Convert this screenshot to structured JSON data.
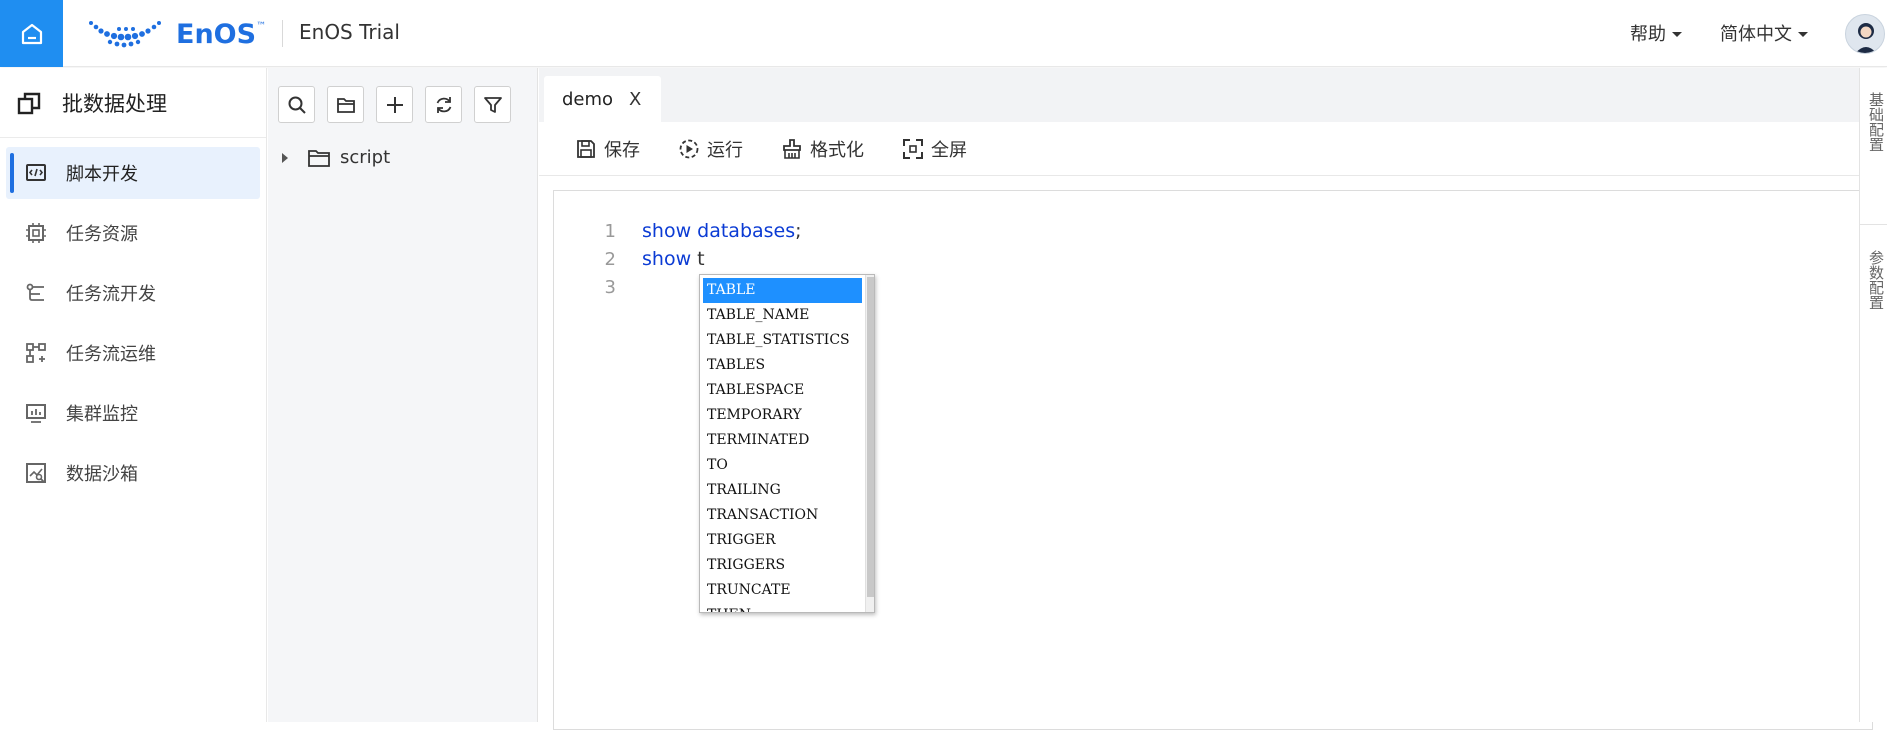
{
  "brand": {
    "logo_text": "EnOS",
    "logo_tm": "™",
    "app_title": "EnOS Trial",
    "accent": "#1f8ef1"
  },
  "top_menu": {
    "help": "帮助",
    "language": "简体中文"
  },
  "sidebar": {
    "title": "批数据处理",
    "items": [
      {
        "label": "脚本开发",
        "icon": "script-dev-icon",
        "active": true
      },
      {
        "label": "任务资源",
        "icon": "task-resource-icon",
        "active": false
      },
      {
        "label": "任务流开发",
        "icon": "workflow-dev-icon",
        "active": false
      },
      {
        "label": "任务流运维",
        "icon": "workflow-ops-icon",
        "active": false
      },
      {
        "label": "集群监控",
        "icon": "cluster-monitor-icon",
        "active": false
      },
      {
        "label": "数据沙箱",
        "icon": "data-sandbox-icon",
        "active": false
      }
    ]
  },
  "tree": {
    "toolbar": [
      "search-icon",
      "folder-icon",
      "add-icon",
      "refresh-icon",
      "filter-icon"
    ],
    "nodes": [
      {
        "label": "script"
      }
    ]
  },
  "editor": {
    "tab": {
      "label": "demo",
      "close": "X"
    },
    "toolbar": {
      "save": "保存",
      "run": "运行",
      "format": "格式化",
      "fullscreen": "全屏"
    },
    "lines": [
      {
        "no": "1",
        "keyword": "show",
        "rest": "databases",
        "punct": ";"
      },
      {
        "no": "2",
        "keyword": "show",
        "rest": "",
        "punct": "t"
      },
      {
        "no": "3",
        "keyword": "",
        "rest": "",
        "punct": ""
      }
    ]
  },
  "autocomplete": {
    "selected_index": 0,
    "items": [
      "TABLE",
      "TABLE_NAME",
      "TABLE_STATISTICS",
      "TABLES",
      "TABLESPACE",
      "TEMPORARY",
      "TERMINATED",
      "TO",
      "TRAILING",
      "TRANSACTION",
      "TRIGGER",
      "TRIGGERS",
      "TRUNCATE",
      "THEN"
    ]
  },
  "right_panel": {
    "text_1": "基础配置",
    "text_2": "参数配置"
  }
}
